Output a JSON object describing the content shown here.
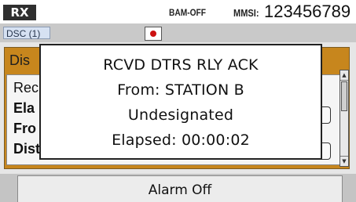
{
  "status_bar": {
    "mode": "RX",
    "bam_status": "BAM-OFF",
    "mmsi_label": "MMSI:",
    "mmsi_value": "123456789"
  },
  "status_row2": {
    "dsc_badge": "DSC (1)",
    "record_indicator_color": "#cc1111"
  },
  "background_window": {
    "title": "Dis",
    "lines": [
      "Rec",
      "Ela",
      "Fro",
      "Distress ID:"
    ]
  },
  "popup": {
    "lines": [
      "RCVD DTRS RLY ACK",
      "From: STATION B",
      "Undesignated",
      "Elapsed: 00:00:02"
    ]
  },
  "bottom": {
    "alarm_off_label": "Alarm Off"
  },
  "colors": {
    "header_accent": "#c7861d",
    "badge_dark": "#2f2f2f"
  }
}
